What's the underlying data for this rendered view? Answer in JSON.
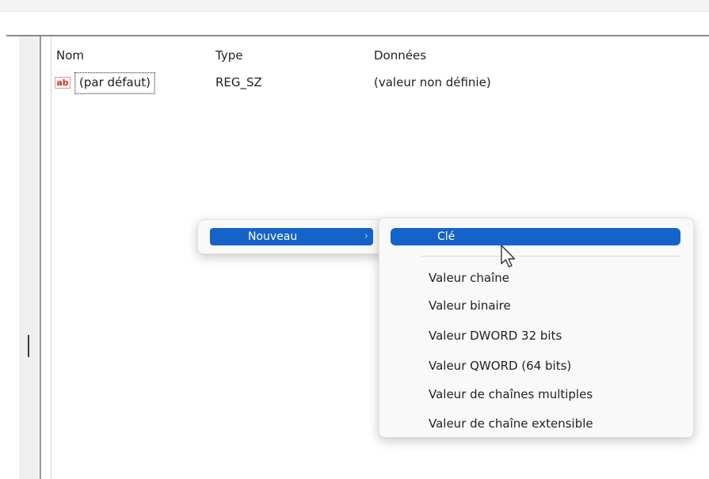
{
  "list": {
    "headers": {
      "name": "Nom",
      "type": "Type",
      "data": "Données"
    },
    "rows": [
      {
        "icon": "string-value-icon",
        "icon_text": "ab",
        "name": "(par défaut)",
        "type": "REG_SZ",
        "data": "(valeur non définie)"
      }
    ]
  },
  "context_menu": {
    "items": [
      {
        "label": "Nouveau",
        "has_submenu": true,
        "highlighted": true
      }
    ],
    "submenu_arrow": "›"
  },
  "submenu": {
    "items": [
      {
        "label": "Clé",
        "highlighted": true
      },
      {
        "label": "Valeur chaîne"
      },
      {
        "label": "Valeur binaire"
      },
      {
        "label": "Valeur DWORD 32 bits"
      },
      {
        "label": "Valeur QWORD (64 bits)"
      },
      {
        "label": "Valeur de chaînes multiples"
      },
      {
        "label": "Valeur de chaîne extensible"
      }
    ]
  },
  "colors": {
    "highlight": "#1563c9",
    "menu_bg": "#f9f9f9",
    "icon_red": "#c0392b"
  }
}
